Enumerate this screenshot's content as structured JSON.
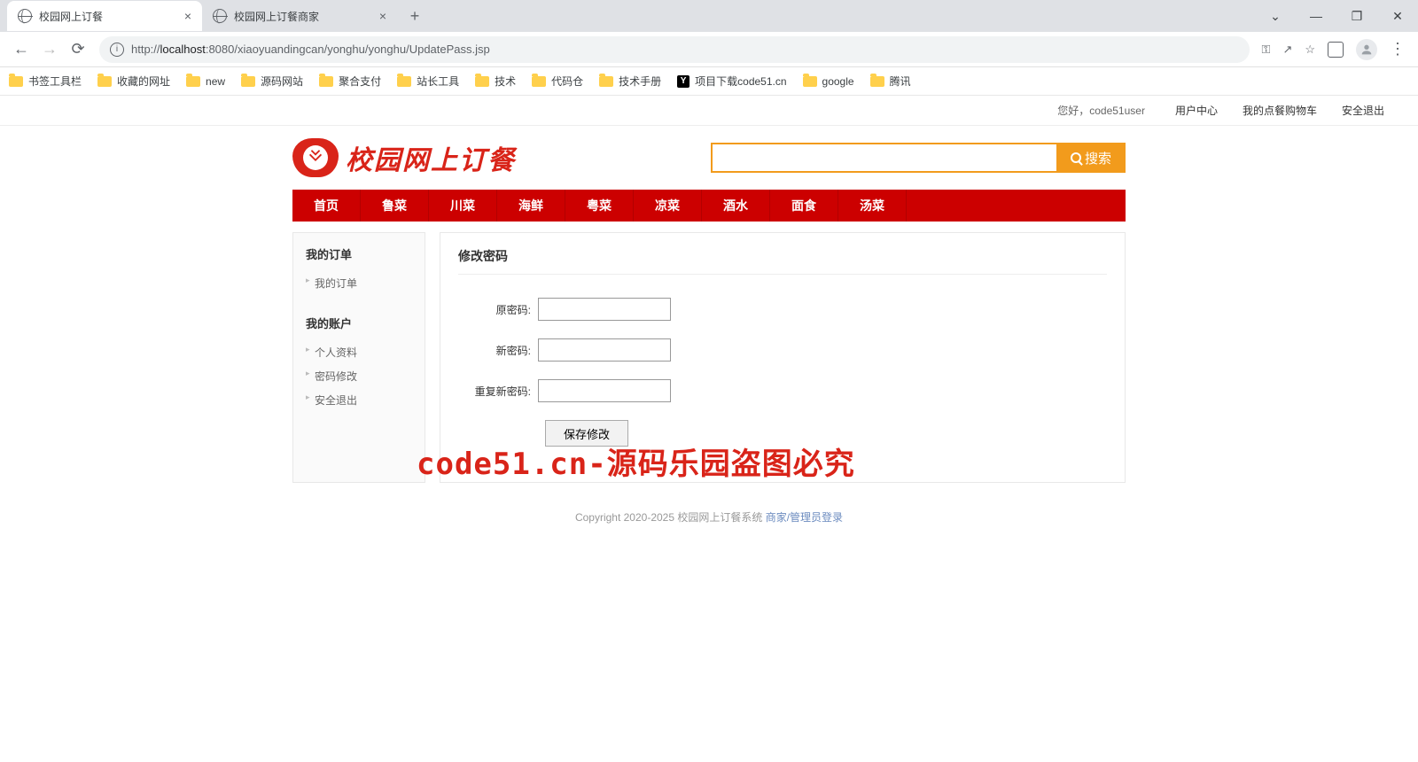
{
  "browser": {
    "tabs": [
      {
        "title": "校园网上订餐"
      },
      {
        "title": "校园网上订餐商家"
      }
    ],
    "url_scheme": "http://",
    "url_host": "localhost",
    "url_port": ":8080",
    "url_path": "/xiaoyuandingcan/yonghu/yonghu/UpdatePass.jsp",
    "bookmarks": [
      "书签工具栏",
      "收藏的网址",
      "new",
      "源码网站",
      "聚合支付",
      "站长工具",
      "技术",
      "代码仓",
      "技术手册",
      "项目下载code51.cn",
      "google",
      "腾讯"
    ]
  },
  "topbar": {
    "greeting_prefix": "您好，",
    "username": "code51user",
    "links": [
      "用户中心",
      "我的点餐购物车",
      "安全退出"
    ]
  },
  "logo_text": "校园网上订餐",
  "search": {
    "placeholder": "",
    "button": "搜索"
  },
  "nav": [
    "首页",
    "鲁菜",
    "川菜",
    "海鲜",
    "粤菜",
    "凉菜",
    "酒水",
    "面食",
    "汤菜"
  ],
  "sidebar": {
    "sec1_title": "我的订单",
    "sec1_links": [
      "我的订单"
    ],
    "sec2_title": "我的账户",
    "sec2_links": [
      "个人资料",
      "密码修改",
      "安全退出"
    ]
  },
  "form": {
    "title": "修改密码",
    "old_label": "原密码:",
    "new_label": "新密码:",
    "repeat_label": "重复新密码:",
    "submit": "保存修改"
  },
  "footer": {
    "copyright": "Copyright 2020-2025 校园网上订餐系统",
    "links": "商家/管理员登录"
  },
  "watermark": "code51.cn-源码乐园盗图必究"
}
